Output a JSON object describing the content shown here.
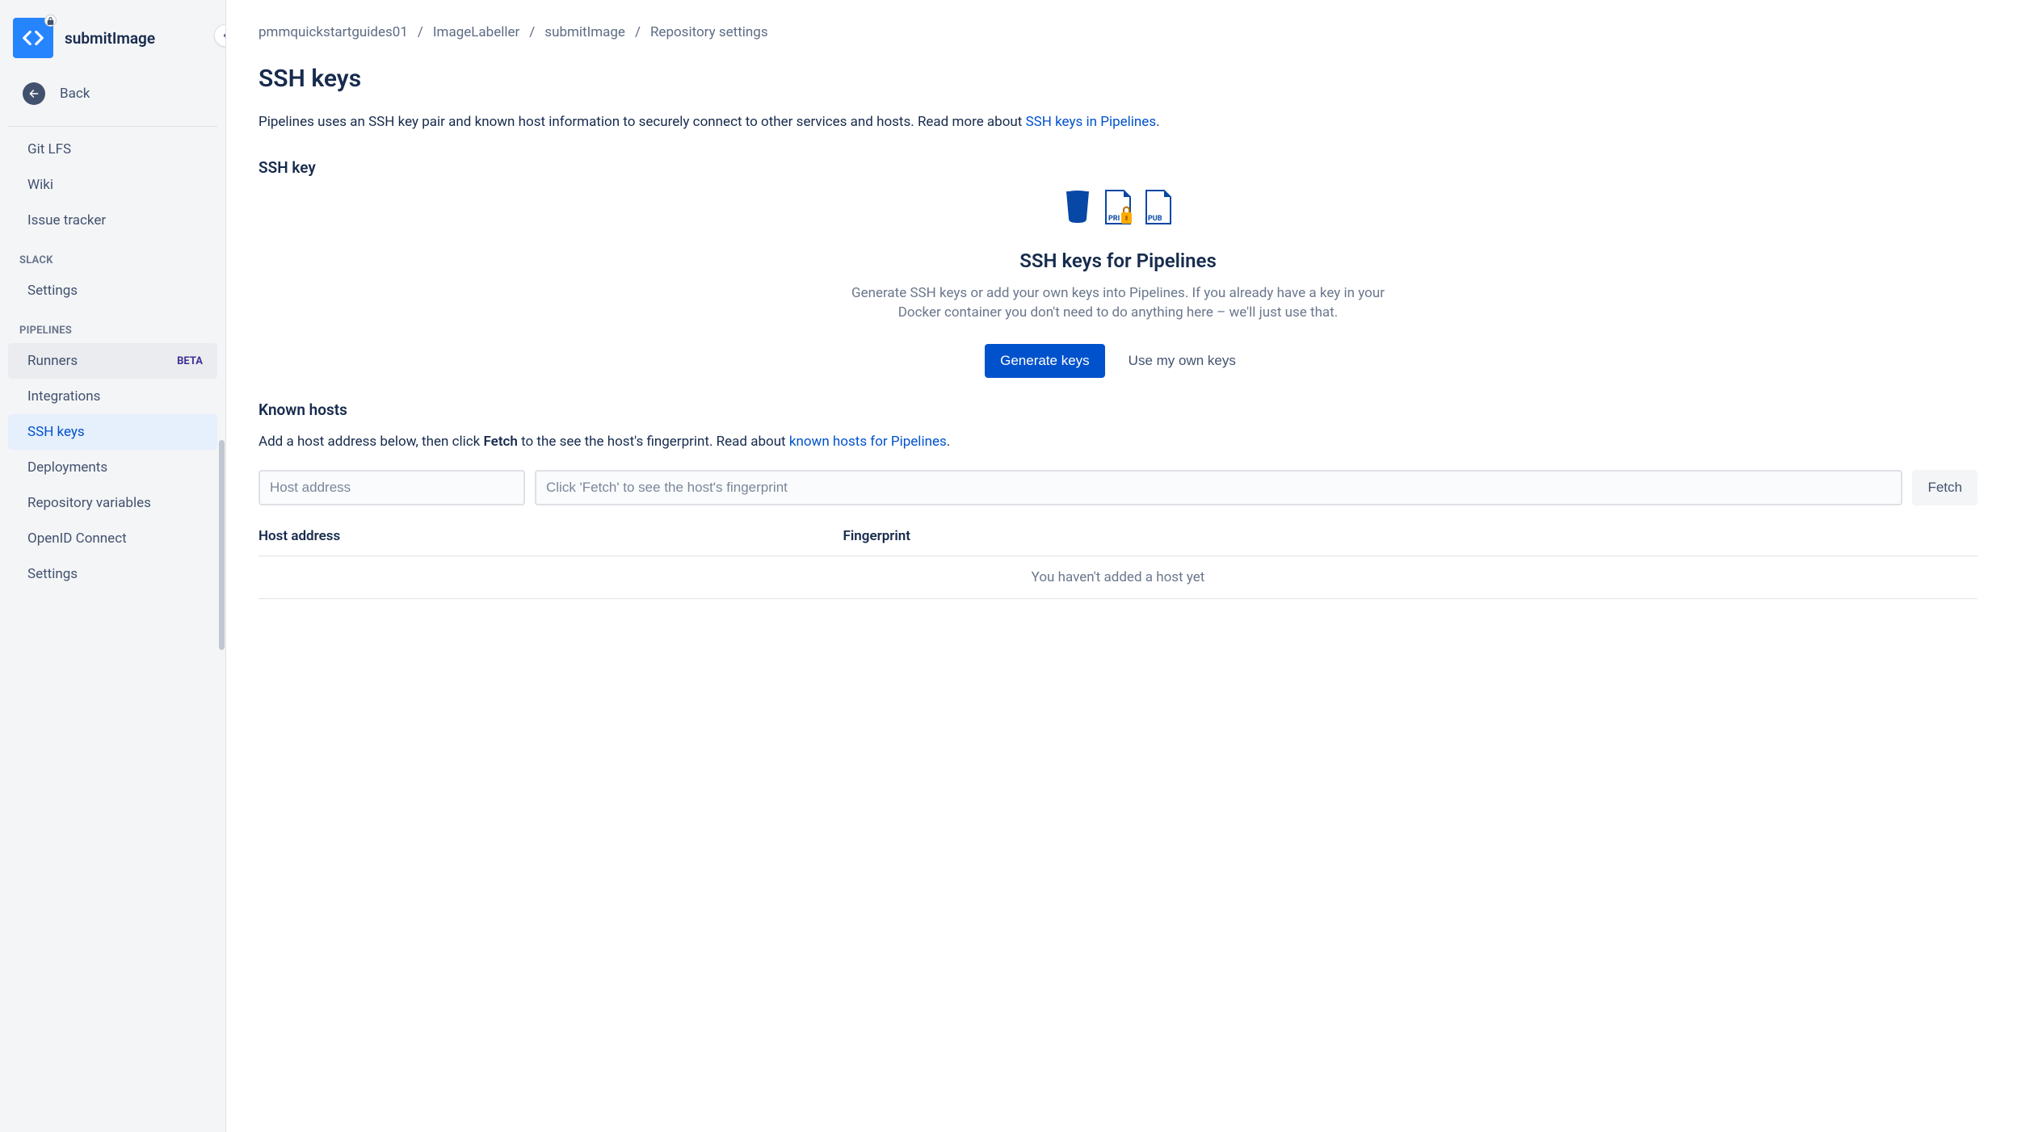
{
  "sidebar": {
    "repo_title": "submitImage",
    "back_label": "Back",
    "items_top": [
      {
        "label": "Git LFS"
      },
      {
        "label": "Wiki"
      },
      {
        "label": "Issue tracker"
      }
    ],
    "slack_heading": "SLACK",
    "slack_items": [
      {
        "label": "Settings"
      }
    ],
    "pipelines_heading": "PIPELINES",
    "pipelines_items": [
      {
        "label": "Runners",
        "badge": "BETA"
      },
      {
        "label": "Integrations"
      },
      {
        "label": "SSH keys"
      },
      {
        "label": "Deployments"
      },
      {
        "label": "Repository variables"
      },
      {
        "label": "OpenID Connect"
      },
      {
        "label": "Settings"
      }
    ]
  },
  "breadcrumb": {
    "c0": "pmmquickstartguides01",
    "c1": "ImageLabeller",
    "c2": "submitImage",
    "c3": "Repository settings"
  },
  "page": {
    "title": "SSH keys",
    "intro_prefix": "Pipelines uses an SSH key pair and known host information to securely connect to other services and hosts. Read more about ",
    "intro_link": "SSH keys in Pipelines",
    "intro_suffix": ".",
    "sshkey_section": "SSH key",
    "hero_title": "SSH keys for Pipelines",
    "hero_desc": "Generate SSH keys or add your own keys into Pipelines. If you already have a key in your Docker container you don't need to do anything here – we'll just use that.",
    "btn_generate": "Generate keys",
    "btn_own": "Use my own keys",
    "known_hosts_section": "Known hosts",
    "kh_desc_1": "Add a host address below, then click ",
    "kh_desc_bold": "Fetch",
    "kh_desc_2": " to the see the host's fingerprint. Read about ",
    "kh_desc_link": "known hosts for Pipelines",
    "kh_desc_3": ".",
    "host_placeholder": "Host address",
    "fp_placeholder": "Click 'Fetch' to see the host's fingerprint",
    "fetch_btn": "Fetch",
    "th_host": "Host address",
    "th_fp": "Fingerprint",
    "empty_hosts": "You haven't added a host yet"
  }
}
